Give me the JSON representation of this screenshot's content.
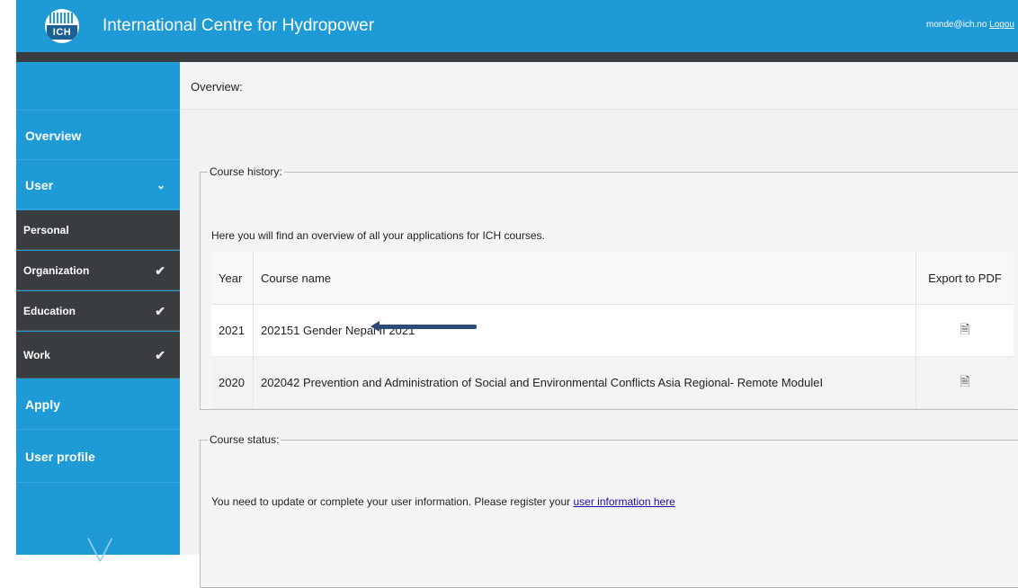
{
  "header": {
    "logo_text": "ICH",
    "title": "International Centre for Hydropower",
    "user_email": "monde@ich.no",
    "logout_label": "Logou"
  },
  "sidebar": {
    "items": [
      {
        "label": "Overview"
      },
      {
        "label": "User",
        "icon": "chevron-down-icon",
        "chevron": "⌄"
      },
      {
        "label": "Apply"
      },
      {
        "label": "User profile"
      }
    ],
    "sub_items": [
      {
        "label": "Personal",
        "checked": false
      },
      {
        "label": "Organization",
        "checked": true
      },
      {
        "label": "Education",
        "checked": true
      },
      {
        "label": "Work",
        "checked": true
      }
    ],
    "check_glyph": "✔"
  },
  "main": {
    "breadcrumb": "Overview:",
    "course_history": {
      "legend": "Course history:",
      "intro": "Here you will find an overview of all your applications for ICH courses.",
      "columns": [
        "Year",
        "Course name",
        "Export to PDF"
      ],
      "rows": [
        {
          "year": "2021",
          "name": "202151 Gender Nepal II 2021"
        },
        {
          "year": "2020",
          "name": "202042 Prevention and Administration of Social and Environmental Conflicts Asia Regional- Remote ModuleI"
        }
      ],
      "export_icon": "pdf-export-icon",
      "export_glyph": "🗎"
    },
    "course_status": {
      "legend": "Course status:",
      "text": "You need to update or complete your user information. Please register your",
      "link": "user information here"
    }
  },
  "colors": {
    "brand_blue": "#1e9ad6",
    "dark_bar": "#3a3d40",
    "annotation_arrow": "#2c4a7a"
  }
}
